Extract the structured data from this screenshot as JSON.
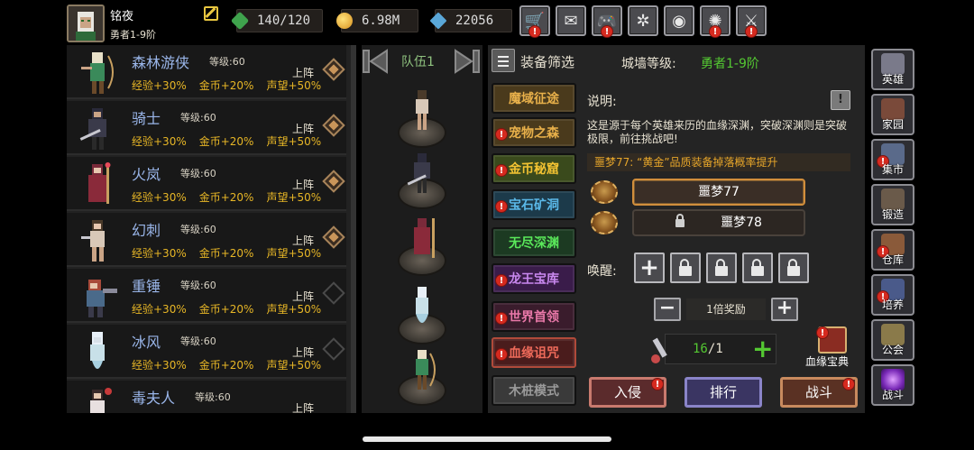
{
  "player": {
    "name": "铭夜",
    "rank": "勇者1-9阶"
  },
  "resources": {
    "energy": "140/120",
    "gold": "6.98M",
    "gems": "22056"
  },
  "top_buttons": [
    {
      "icon": "shop-cart-icon",
      "glyph": "🛒"
    },
    {
      "icon": "mail-icon",
      "glyph": "✉"
    },
    {
      "icon": "gamepad-icon",
      "glyph": "🎮"
    },
    {
      "icon": "settings-gear-icon",
      "glyph": "✲"
    },
    {
      "icon": "color-wheel-icon",
      "glyph": "◉"
    },
    {
      "icon": "fireworks-icon",
      "glyph": "✺"
    },
    {
      "icon": "crossed-swords-icon",
      "glyph": "⚔"
    }
  ],
  "hero_level_label": "等级:",
  "deploy_label": "上阵",
  "heroes": [
    {
      "name": "森林游侠",
      "level": "60",
      "exp": "经验+30%",
      "gold": "金币+20%",
      "fame": "声望+50%",
      "deployed": true
    },
    {
      "name": "骑士",
      "level": "60",
      "exp": "经验+30%",
      "gold": "金币+20%",
      "fame": "声望+50%",
      "deployed": true
    },
    {
      "name": "火岚",
      "level": "60",
      "exp": "经验+30%",
      "gold": "金币+20%",
      "fame": "声望+50%",
      "deployed": true
    },
    {
      "name": "幻刺",
      "level": "60",
      "exp": "经验+30%",
      "gold": "金币+20%",
      "fame": "声望+50%",
      "deployed": true
    },
    {
      "name": "重锤",
      "level": "60",
      "exp": "经验+30%",
      "gold": "金币+20%",
      "fame": "声望+50%",
      "deployed": false
    },
    {
      "name": "冰风",
      "level": "60",
      "exp": "经验+30%",
      "gold": "金币+20%",
      "fame": "声望+50%",
      "deployed": false
    },
    {
      "name": "毒夫人",
      "level": "60",
      "exp": "",
      "gold": "",
      "fame": "",
      "deployed": false
    }
  ],
  "team": {
    "title": "队伍1"
  },
  "panel": {
    "filter_label": "装备筛选",
    "wall_label": "城墙等级:",
    "wall_value": "勇者1-9阶",
    "dungeons": [
      {
        "label": "魔域征途",
        "bg": "#4a3a1c",
        "fg": "#e8b04a",
        "badge": false
      },
      {
        "label": "宠物之森",
        "bg": "#4a3a1c",
        "fg": "#e8b04a",
        "badge": true
      },
      {
        "label": "金币秘窟",
        "bg": "#3a4a1c",
        "fg": "#f2c232",
        "badge": true
      },
      {
        "label": "宝石矿洞",
        "bg": "#1c3a4a",
        "fg": "#5ab8e8",
        "badge": true
      },
      {
        "label": "无尽深渊",
        "bg": "#1c3a22",
        "fg": "#5ae85a",
        "badge": false
      },
      {
        "label": "龙王宝库",
        "bg": "#3a1c4a",
        "fg": "#c888ee",
        "badge": true
      },
      {
        "label": "世界首领",
        "bg": "#3a1c2c",
        "fg": "#e878a8",
        "badge": true
      },
      {
        "label": "血缘诅咒",
        "bg": "#4a1c1c",
        "fg": "#ee6a5a",
        "badge": true
      },
      {
        "label": "木桩模式",
        "bg": "#3a3a3a",
        "fg": "#9a9a9a",
        "badge": false
      }
    ],
    "desc_title": "说明:",
    "desc_text": "这是源于每个英雄来历的血缘深渊，突破深渊则是突破极限，前往挑战吧!",
    "notice": "噩梦77: “黄金”品质装备掉落概率提升",
    "nightmares": [
      {
        "label": "噩梦77",
        "locked": false
      },
      {
        "label": "噩梦78",
        "locked": true
      }
    ],
    "awaken_label": "唤醒:",
    "multiplier_label": "1倍奖励",
    "ticket_current": "16",
    "ticket_max": "/1",
    "codex_label": "血缘宝典",
    "buttons": {
      "invade": "入侵",
      "rank": "排行",
      "battle": "战斗"
    }
  },
  "nav": [
    {
      "label": "英雄",
      "icon": "hero-helmet-icon",
      "color": "#7a7a8a",
      "badge": false
    },
    {
      "label": "家园",
      "icon": "home-castle-icon",
      "color": "#7a4a3a",
      "badge": false
    },
    {
      "label": "集市",
      "icon": "market-stall-icon",
      "color": "#5a6a8a",
      "badge": true
    },
    {
      "label": "锻造",
      "icon": "anvil-hammer-icon",
      "color": "#6a5a4a",
      "badge": false
    },
    {
      "label": "仓库",
      "icon": "warehouse-chest-icon",
      "color": "#8a5a3a",
      "badge": true
    },
    {
      "label": "培养",
      "icon": "training-crown-icon",
      "color": "#4a5a8a",
      "badge": true
    },
    {
      "label": "公会",
      "icon": "guild-shield-icon",
      "color": "#8a7a4a",
      "badge": false
    },
    {
      "label": "战斗",
      "icon": "battle-portal-icon",
      "color": "#7a2ab8",
      "badge": false
    }
  ]
}
